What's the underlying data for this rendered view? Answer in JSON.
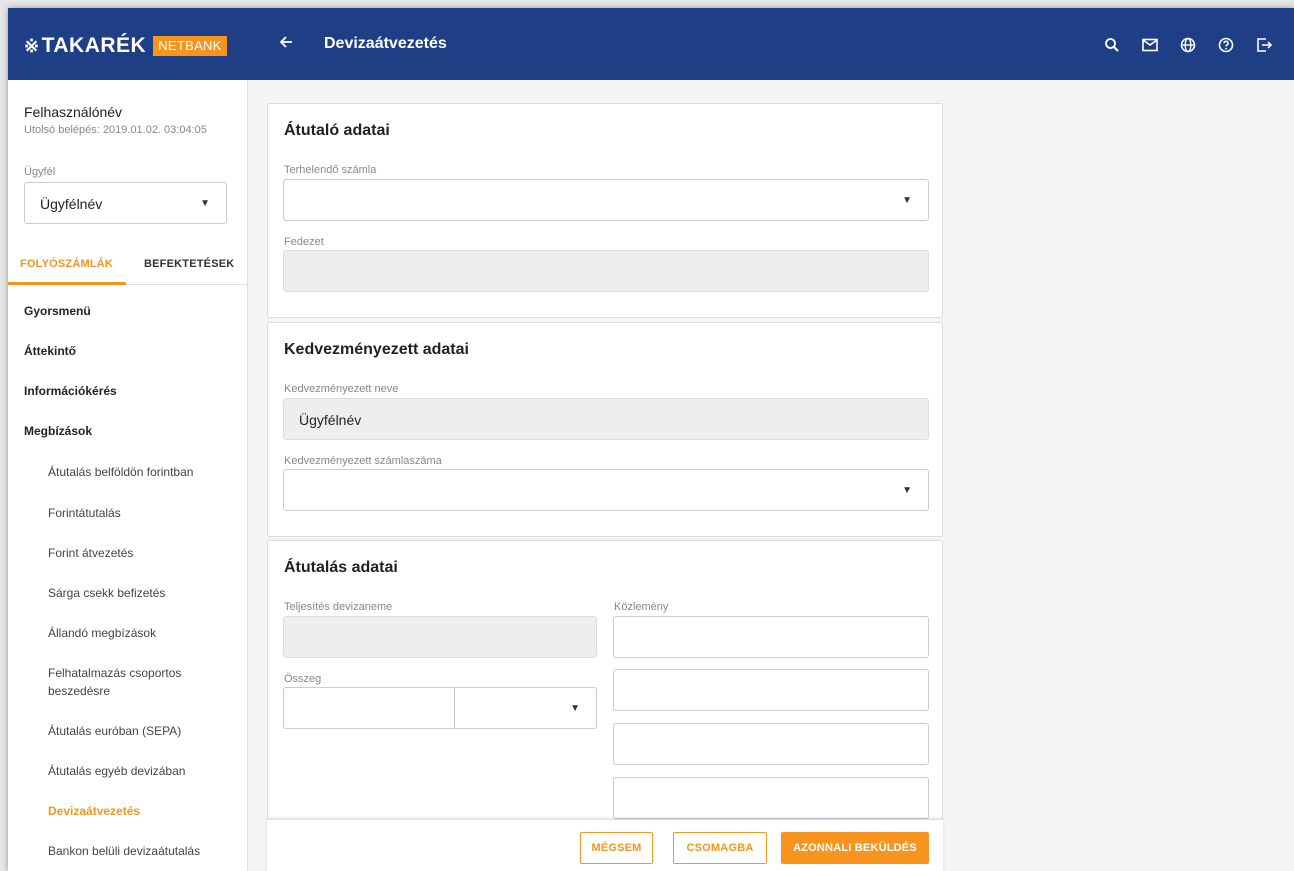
{
  "header": {
    "logo_mark": "※",
    "logo_text": "TAKARÉK",
    "logo_badge": "NETBANK",
    "back_icon": "arrow-left-icon",
    "title": "Devizaátvezetés",
    "icons": [
      "search-icon",
      "mail-icon",
      "globe-icon",
      "help-icon",
      "logout-icon"
    ]
  },
  "sidebar": {
    "user_name": "Felhasználónév",
    "last_login": "Utolsó belépés: 2019.01.02. 03:04:05",
    "client_label": "Ügyfél",
    "client_value": "Ügyfélnév",
    "tabs": [
      "FOLYÓSZÁMLÁK",
      "BEFEKTETÉSEK"
    ],
    "active_tab": "FOLYÓSZÁMLÁK",
    "nav": [
      "Gyorsmenü",
      "Áttekintő",
      "Információkérés",
      "Megbízások"
    ],
    "sub_items": [
      "Átutalás belföldön forintban",
      "Forintátutalás",
      "Forint átvezetés",
      "Sárga csekk befizetés",
      "Állandó megbízások",
      "Felhatalmazás csoportos beszedésre",
      "Átutalás euróban (SEPA)",
      "Átutalás egyéb devizában",
      "Devizaátvezetés",
      "Bankon belüli devizaátutalás"
    ],
    "active_sub_item": "Devizaátvezetés"
  },
  "card_sender": {
    "title": "Átutaló adatai",
    "account_label": "Terhelendő számla",
    "account_value": "",
    "coverage_label": "Fedezet",
    "coverage_value": ""
  },
  "card_beneficiary": {
    "title": "Kedvezményezett adatai",
    "name_label": "Kedvezményezett neve",
    "name_value": "Ügyfélnév",
    "account_label": "Kedvezményezett számlaszáma",
    "account_value": ""
  },
  "card_transfer": {
    "title": "Átutalás adatai",
    "currency_label": "Teljesítés devizaneme",
    "currency_value": "",
    "amount_label": "Összeg",
    "amount_value": "",
    "amount_currency_value": "",
    "comment_label": "Közlemény",
    "comment_lines": [
      "",
      "",
      "",
      ""
    ]
  },
  "actions": {
    "cancel": "MÉGSEM",
    "package": "CSOMAGBA",
    "send_now": "AZONNALI BEKÜLDÉS"
  },
  "colors": {
    "header_bg": "#1e3f85",
    "accent": "#f7941d"
  }
}
